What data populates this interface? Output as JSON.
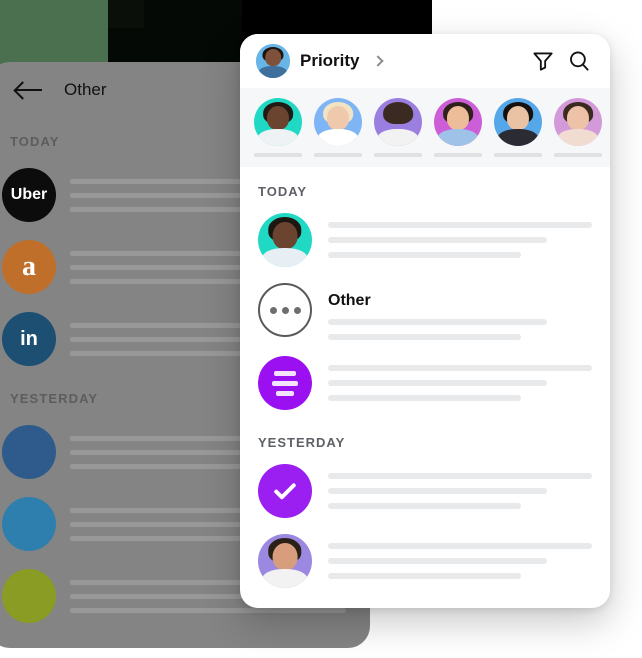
{
  "background_card": {
    "header": {
      "back_icon": "back-arrow-icon",
      "title": "Other"
    },
    "sections": [
      {
        "label": "TODAY",
        "rows": [
          {
            "logo_name": "uber-logo",
            "logo_text": "Uber",
            "logo_color": "#0c0c0c",
            "lines": [
              100,
              96,
              92
            ]
          },
          {
            "logo_name": "amazon-logo",
            "logo_text": "a",
            "logo_color": "#c06f2a",
            "lines": [
              100,
              96,
              92
            ]
          },
          {
            "logo_name": "linkedin-logo",
            "logo_text": "in",
            "logo_color": "#1c4f72",
            "lines": [
              100,
              96,
              92
            ]
          }
        ]
      },
      {
        "label": "YESTERDAY",
        "rows": [
          {
            "logo_name": "dropbox-logo",
            "logo_text": "",
            "logo_color": "#2f5b8c",
            "lines": [
              100,
              96,
              92
            ]
          },
          {
            "logo_name": "twitter-logo",
            "logo_text": "",
            "logo_color": "#2e7fae",
            "lines": [
              100,
              96,
              92
            ]
          },
          {
            "logo_name": "mailchimp-logo",
            "logo_text": "",
            "logo_color": "#8a9c23",
            "lines": [
              100,
              96,
              92
            ]
          }
        ]
      }
    ]
  },
  "main_card": {
    "header": {
      "avatar_name": "account-avatar",
      "title": "Priority",
      "chevron_icon": "chevron-right-icon",
      "filter_icon": "filter-icon",
      "search_icon": "search-icon"
    },
    "stories": [
      {
        "name": "story-avatar-1",
        "bg": "#1fd9c5",
        "skin": "#6b4430",
        "hair": "#221a15",
        "shirt": "#eef2f5"
      },
      {
        "name": "story-avatar-2",
        "bg": "#7fb4f5",
        "skin": "#f0c9ad",
        "hair": "#f2e3c2",
        "shirt": "#ffffff"
      },
      {
        "name": "story-avatar-3",
        "bg": "#9b7fe0",
        "skin": "#e2b furthermore",
        "hair": "#3a2a22",
        "shirt": "#f2f2f2"
      },
      {
        "name": "story-avatar-4",
        "bg": "#cc5fd8",
        "skin": "#edbd9a",
        "hair": "#2e2119",
        "shirt": "#9fc3e8"
      },
      {
        "name": "story-avatar-5",
        "bg": "#56a6ea",
        "skin": "#e9c3a4",
        "hair": "#14110f",
        "shirt": "#2b2b33"
      },
      {
        "name": "story-avatar-6",
        "bg": "#d39ad9",
        "skin": "#edc2a6",
        "hair": "#3a2a20",
        "shirt": "#f0dcd0"
      }
    ],
    "sections": [
      {
        "label": "TODAY",
        "rows": [
          {
            "avatar_name": "contact-avatar",
            "avatar_kind": "photo",
            "bg": "#1fd9c5",
            "skin": "#6b4430",
            "hair": "#1d1611",
            "shirt": "#e7eef4",
            "title": "",
            "lines": [
              100,
              83,
              73
            ]
          },
          {
            "avatar_name": "other-dots-icon",
            "avatar_kind": "dots",
            "title": "Other",
            "lines": [
              83,
              73
            ]
          },
          {
            "avatar_name": "list-lines-icon",
            "avatar_kind": "lines",
            "title": "",
            "lines": [
              100,
              83,
              73
            ]
          }
        ]
      },
      {
        "label": "YESTERDAY",
        "rows": [
          {
            "avatar_name": "check-icon",
            "avatar_kind": "check",
            "title": "",
            "lines": [
              100,
              83,
              73
            ]
          },
          {
            "avatar_name": "contact-avatar",
            "avatar_kind": "photo",
            "bg": "#9b88e0",
            "skin": "#d79d7c",
            "hair": "#2b2017",
            "shirt": "#f2f2f2",
            "title": "",
            "lines": [
              100,
              83,
              73
            ]
          }
        ]
      }
    ]
  },
  "colors": {
    "accent_purple": "#9b10f0",
    "deco_green": "#4a7050",
    "deco_dark": "#050905",
    "dim_overlay": "#848484",
    "skeleton": "#e8e9ea",
    "strip_bg": "#f6f7f8"
  }
}
